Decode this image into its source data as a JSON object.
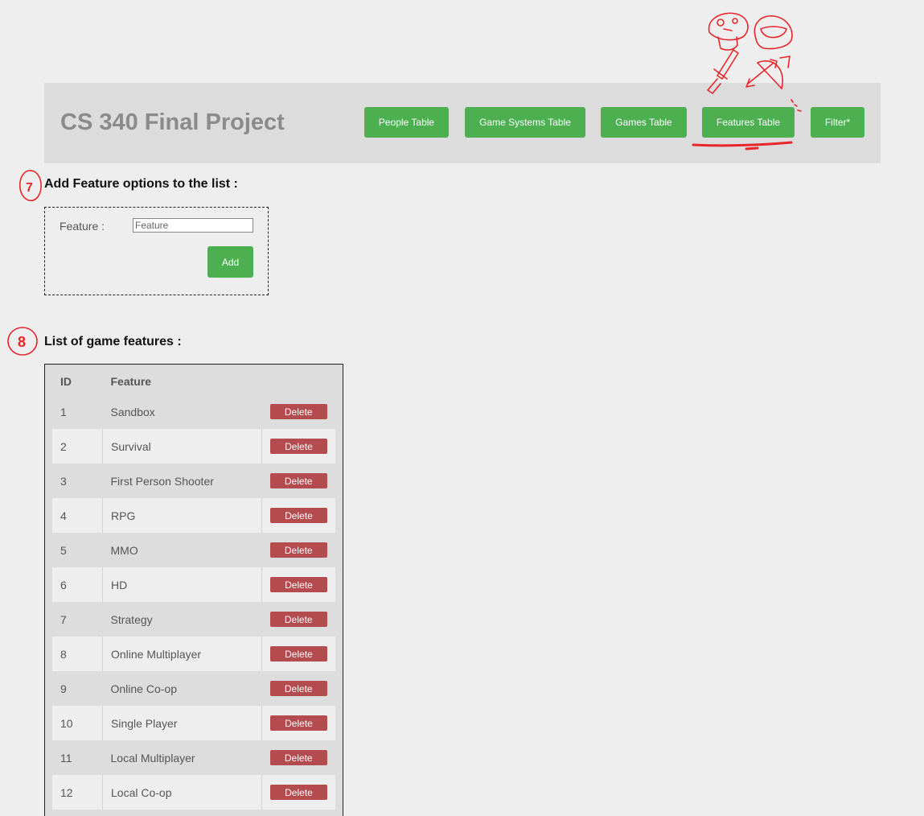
{
  "header": {
    "title": "CS 340 Final Project",
    "nav": {
      "people": "People Table",
      "game_systems": "Game Systems Table",
      "games": "Games Table",
      "features": "Features Table",
      "filter": "Filter*"
    }
  },
  "add_section": {
    "heading": "Add Feature options to the list :",
    "feature_label": "Feature :",
    "feature_placeholder": "Feature",
    "feature_value": "",
    "add_label": "Add"
  },
  "list_section": {
    "heading": "List of game features :",
    "columns": [
      "ID",
      "Feature"
    ],
    "rows": [
      {
        "id": "1",
        "feature": "Sandbox",
        "action": "Delete"
      },
      {
        "id": "2",
        "feature": "Survival",
        "action": "Delete"
      },
      {
        "id": "3",
        "feature": "First Person Shooter",
        "action": "Delete"
      },
      {
        "id": "4",
        "feature": "RPG",
        "action": "Delete"
      },
      {
        "id": "5",
        "feature": "MMO",
        "action": "Delete"
      },
      {
        "id": "6",
        "feature": "HD",
        "action": "Delete"
      },
      {
        "id": "7",
        "feature": "Strategy",
        "action": "Delete"
      },
      {
        "id": "8",
        "feature": "Online Multiplayer",
        "action": "Delete"
      },
      {
        "id": "9",
        "feature": "Online Co-op",
        "action": "Delete"
      },
      {
        "id": "10",
        "feature": "Single Player",
        "action": "Delete"
      },
      {
        "id": "11",
        "feature": "Local Multiplayer",
        "action": "Delete"
      },
      {
        "id": "12",
        "feature": "Local Co-op",
        "action": "Delete"
      }
    ]
  },
  "annotations": {
    "step_add": "7",
    "step_list": "8",
    "color": "#e8262a"
  },
  "colors": {
    "nav_button": "#4caf50",
    "delete_button": "#b34b4f",
    "header_bg": "#dcdcdc",
    "page_bg": "#eeeeee"
  }
}
